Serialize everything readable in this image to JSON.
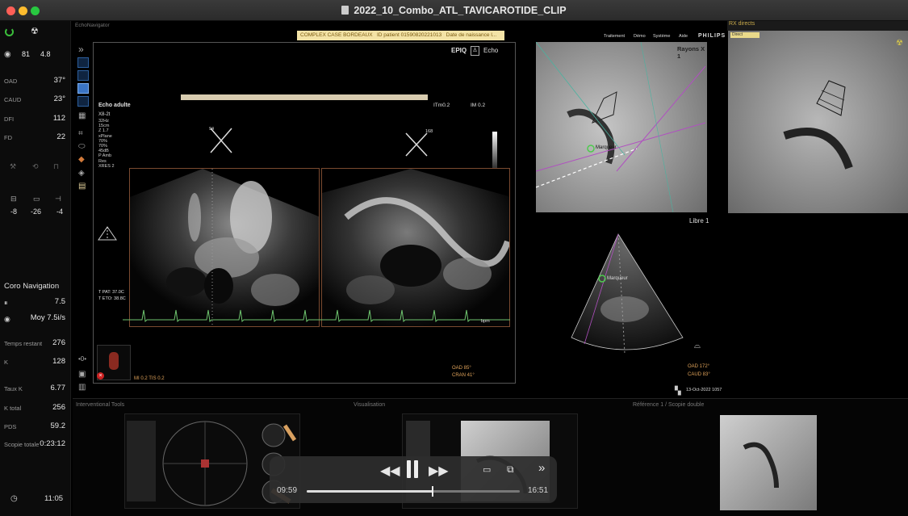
{
  "window": {
    "title": "2022_10_Combo_ATL_TAVICAROTIDE_CLIP"
  },
  "left": {
    "vitals": [
      {
        "icon": "eye-icon",
        "value": "81"
      },
      {
        "value": "4.8"
      }
    ],
    "angles": [
      {
        "label": "OAD",
        "value": "37°"
      },
      {
        "label": "CAUD",
        "value": "23°"
      },
      {
        "label": "DFI",
        "value": "112"
      },
      {
        "label": "FD",
        "value": "22"
      }
    ],
    "tilt": [
      "-8",
      "-26",
      "-4"
    ],
    "coro_title": "Coro Navigation",
    "coro_rate": "7.5",
    "coro_moy": "Moy 7.5i/s",
    "stats": [
      {
        "label": "Temps restant",
        "value": "276"
      },
      {
        "label": "K",
        "value": "128"
      },
      {
        "label": "Taux K",
        "value": "6.77"
      },
      {
        "label": "K total",
        "value": "256"
      },
      {
        "label": "PDS",
        "value": "59.2"
      },
      {
        "label": "Scopie totale",
        "value": "0:23:12"
      }
    ],
    "clock": "11:05"
  },
  "echo": {
    "panel_title": "EchoNavigator",
    "brand": "EPIQ",
    "mode": "Echo",
    "preset": "Echo adulte",
    "probe": "X8-2t",
    "params": [
      "32Hz",
      "15cm",
      "Z 1.7",
      "xPlane",
      "70%",
      "70%",
      "45dB",
      "P Amb",
      "Res",
      "XRES 2"
    ],
    "tim": "ITm0.2",
    "im": "IM 0.2",
    "angle_left": "94",
    "angle_right": "168",
    "temps": [
      "T PAT: 37.0C",
      "T ETO: 38.8C"
    ],
    "footer_left": "MI 0.2  TIS 0.2",
    "oad": "OAD 85°",
    "cran": "CRAN 41°",
    "bpm": "bpm"
  },
  "banner": {
    "case": "COMPLEX CASE BORDEAUX",
    "id": "ID patient 01590820221013",
    "dob": "Date de naissance l..."
  },
  "menu": [
    "Traitement",
    "Démo",
    "Système",
    "Aide",
    "PHILIPS"
  ],
  "xray": {
    "label": "Rayons X 1",
    "marker": "Marqueur"
  },
  "libre": {
    "title": "Libre 1",
    "marker": "Marqueur",
    "oad": "OAD 172°",
    "caud": "CAUD 83°",
    "date": "13-Oct-2022 1057"
  },
  "rx": {
    "title": "RX directs",
    "badge": "Direct"
  },
  "bottom": {
    "tools_title": "Interventional Tools",
    "vis_title": "Visualisation",
    "ref_title": "Référence 1 / Scopie double"
  },
  "player": {
    "elapsed": "09:59",
    "remaining": "16:51",
    "progress": 0.59
  }
}
